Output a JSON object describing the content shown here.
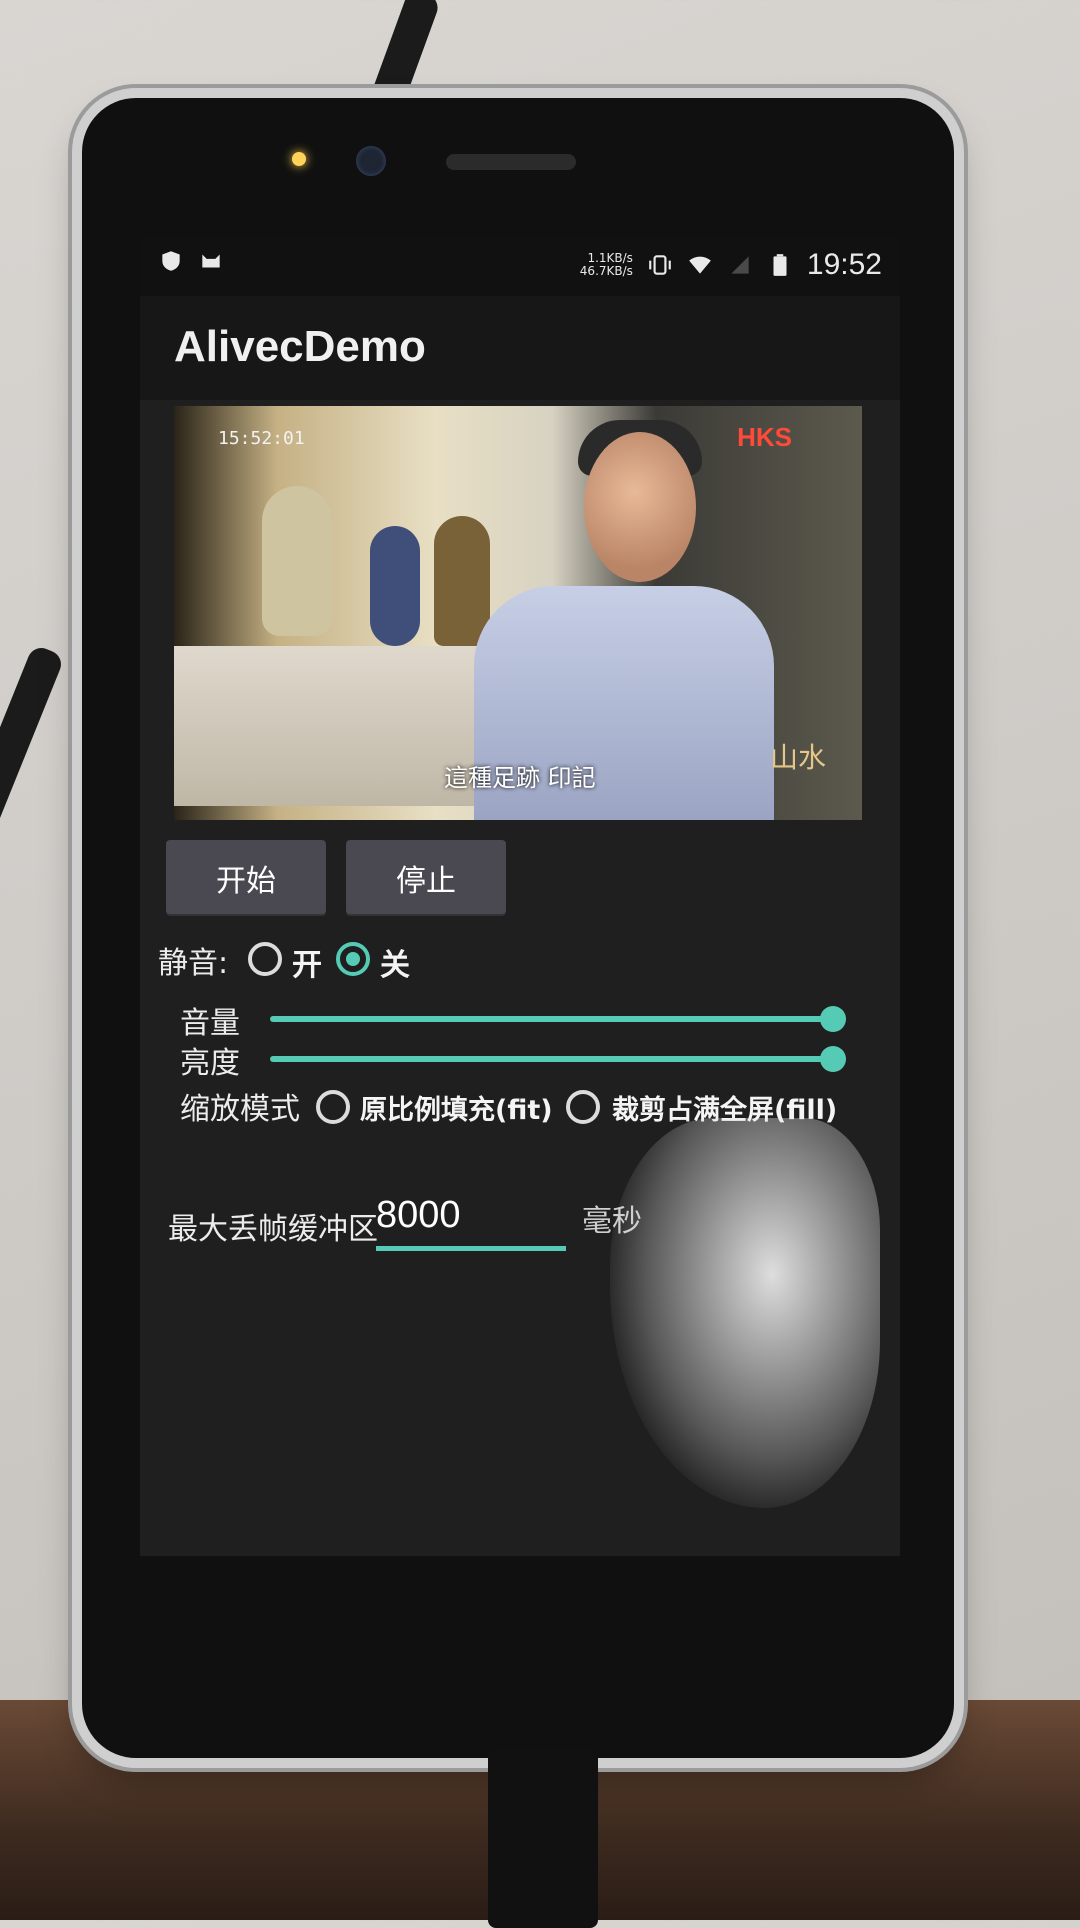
{
  "status_bar": {
    "net_up": "1.1KB/s",
    "net_down": "46.7KB/s",
    "time": "19:52",
    "icons": [
      "shield-icon",
      "cat-icon",
      "vibrate-icon",
      "wifi-icon",
      "signal-icon",
      "battery-icon"
    ]
  },
  "app": {
    "title": "AlivecDemo"
  },
  "video": {
    "timestamp": "15:52:01",
    "channel_logo": "HKS",
    "caption": "這種足跡 印記",
    "corner_mark": "山水"
  },
  "controls": {
    "start_label": "开始",
    "stop_label": "停止",
    "mute_label": "静音:",
    "mute_on_label": "开",
    "mute_off_label": "关",
    "mute_selected": "off",
    "volume_label": "音量",
    "volume_value": 1.0,
    "brightness_label": "亮度",
    "brightness_value": 1.0,
    "zoom_label": "缩放模式",
    "zoom_fit_label": "原比例填充(fit)",
    "zoom_fill_label": "裁剪占满全屏(fill)",
    "buffer_label": "最大丢帧缓冲区",
    "buffer_value": "8000",
    "buffer_unit": "毫秒"
  },
  "colors": {
    "accent": "#55cbb6",
    "button_bg": "#4a4850",
    "screen_bg": "#1f1f1f"
  }
}
